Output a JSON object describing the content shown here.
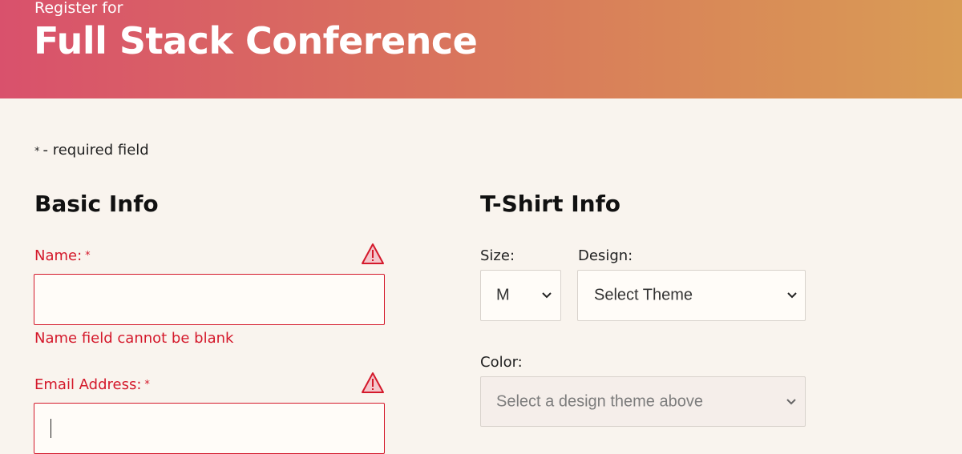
{
  "header": {
    "kicker": "Register for",
    "title": "Full Stack Conference"
  },
  "required_note": {
    "star": "*",
    "text": "- required field"
  },
  "basic_info": {
    "title": "Basic Info",
    "name": {
      "label": "Name:",
      "required_mark": "*",
      "value": "",
      "error": "Name field cannot be blank",
      "icon": "warning-icon"
    },
    "email": {
      "label": "Email Address:",
      "required_mark": "*",
      "value": "",
      "icon": "warning-icon"
    }
  },
  "tshirt_info": {
    "title": "T-Shirt Info",
    "size": {
      "label": "Size:",
      "selected": "M"
    },
    "design": {
      "label": "Design:",
      "selected": "Select Theme"
    },
    "color": {
      "label": "Color:",
      "selected": "Select a design theme above",
      "disabled": true
    }
  },
  "colors": {
    "error": "#d4192b",
    "header_gradient_start": "#d9516c",
    "header_gradient_end": "#d99c55",
    "page_background": "#f9f4ee"
  }
}
